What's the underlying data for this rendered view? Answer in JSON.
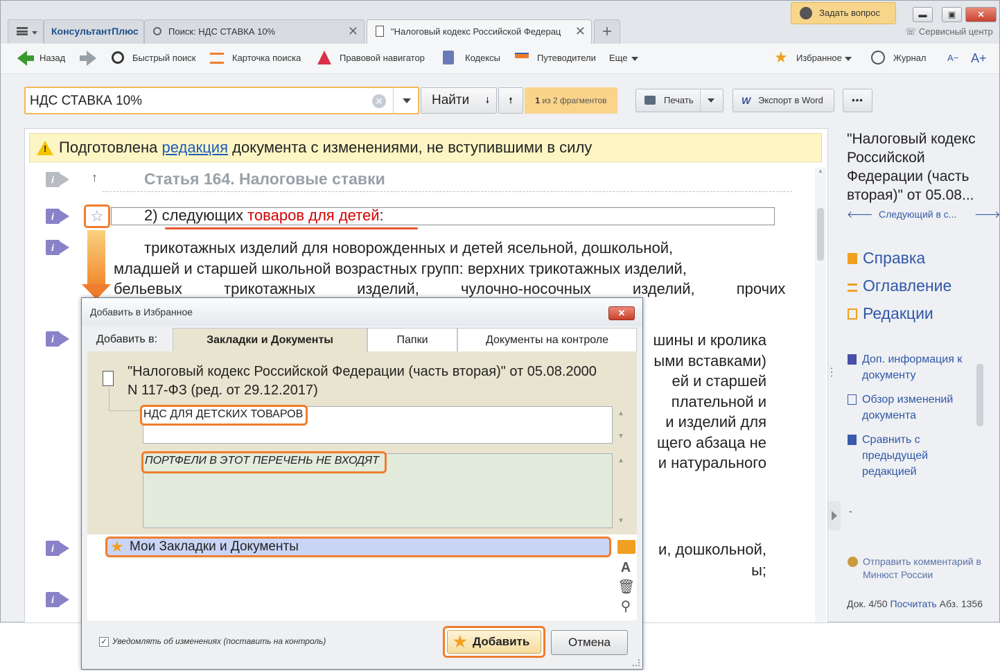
{
  "tabs": {
    "logo": "КонсультантПлюс",
    "search_tab": "Поиск: НДС СТАВКА 10%",
    "doc_tab": "\"Налоговый кодекс Российской Федерац",
    "close": "✕",
    "plus": "+"
  },
  "window": {
    "ask_question": "Задать вопрос",
    "service_center": "Сервисный центр",
    "minimize": "▬",
    "maximize": "▣",
    "close": "✕"
  },
  "toolbar": {
    "back": "Назад",
    "quick_search": "Быстрый поиск",
    "search_card": "Карточка поиска",
    "legal_navigator": "Правовой навигатор",
    "codes": "Кодексы",
    "guides": "Путеводители",
    "more": "Еще",
    "favorites": "Избранное",
    "journal": "Журнал",
    "font_minus": "A−",
    "font_plus": "A+"
  },
  "search": {
    "value": "НДС СТАВКА 10%",
    "clear": "✕",
    "find": "Найти",
    "down": "🠗",
    "up": "🠕",
    "frag_count": "1",
    "frag_text": " из 2 фрагментов",
    "print": "Печать",
    "export_w": "W",
    "export": "Экспорт в Word",
    "more": "•••"
  },
  "document": {
    "banner_pre": "Подготовлена ",
    "banner_link": "редакция",
    "banner_post": " документа с изменениями, не вступившими в силу",
    "article_title": "Статья 164. Налоговые ставки",
    "up_arrow": "↑",
    "item_pre": "2) следующих ",
    "item_red": "товаров для детей",
    "item_post": ":",
    "star": "☆",
    "info": "i",
    "para1": [
      "трикотажных изделий для новорожденных и детей ясельной, дошкольной,",
      "младшей и старшей школьной возрастных групп: верхних трикотажных изделий,",
      "бельевых трикотажных изделий, чулочно-носочных изделий, прочих"
    ],
    "para2": [
      "шины и кролика",
      "ыми вставками)",
      "ей и старшей",
      "плательной и",
      "и изделий для",
      "щего абзаца не",
      "и натурального"
    ],
    "para3": [
      "и, дошкольной,",
      "ы;"
    ]
  },
  "right_panel": {
    "title": "\"Налоговый кодекс Российской Федерации (часть вторая)\" от 05.08...",
    "prev": "🡐",
    "next_in": "Следующий в с...",
    "next": "🡒",
    "help": "Справка",
    "contents": "Оглавление",
    "revisions": "Редакции",
    "add_info": "Доп. информация к документу",
    "changes_review": "Обзор изменений документа",
    "compare": "Сравнить с предыдущей редакцией",
    "dash": "-",
    "send_comment": "Отправить комментарий в Минюст России",
    "doc_pos": "Док. 4/50 ",
    "count_link": "Посчитать",
    "abz": " Абз. 1356"
  },
  "dialog": {
    "title": "Добавить в Избранное",
    "close": "✕",
    "add_to": "Добавить в:",
    "tab_bookmarks": "Закладки и Документы",
    "tab_folders": "Папки",
    "tab_control": "Документы на контроле",
    "doc_name": "\"Налоговый кодекс Российской Федерации (часть вторая)\" от 05.08.2000 N 117-ФЗ (ред. от 29.12.2017)",
    "bookmark_name": "НДС ДЛЯ ДЕТСКИХ ТОВАРОВ",
    "comment": "ПОРТФЕЛИ В ЭТОТ ПЕРЕЧЕНЬ НЕ ВХОДЯТ",
    "folder": "Мои Закладки и Документы",
    "star": "★",
    "notify": "Уведомлять об изменениях (поставить на контроль)",
    "check": "✓",
    "add": "Добавить",
    "cancel": "Отмена",
    "scroll_up": "▲",
    "scroll_down": "▼",
    "tool_rename": "A",
    "tool_delete": "🗑",
    "tool_find": "⚲"
  }
}
